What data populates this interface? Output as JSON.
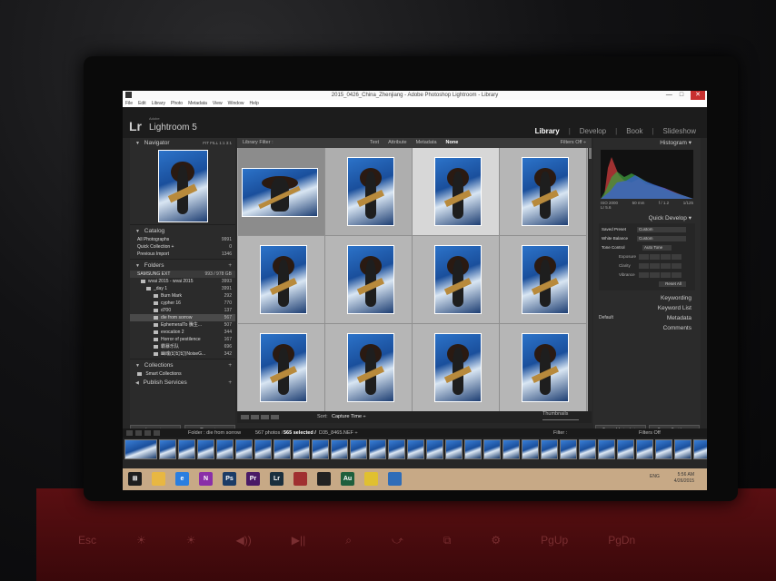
{
  "window": {
    "title": "2015_0426_China_Zhenjiang - Adobe Photoshop Lightroom - Library",
    "minimize": "—",
    "maximize": "□",
    "close": "✕"
  },
  "menu": [
    "File",
    "Edit",
    "Library",
    "Photo",
    "Metadata",
    "View",
    "Window",
    "Help"
  ],
  "identity": {
    "logo": "Lr",
    "brand": "Adobe",
    "product": "Lightroom 5"
  },
  "modules": {
    "items": [
      "Library",
      "Develop",
      "Book",
      "Slideshow"
    ],
    "active": "Library",
    "sep": "|"
  },
  "left": {
    "navigator": {
      "title": "Navigator",
      "zoom": "FIT FILL 1:1 3:1"
    },
    "catalog": {
      "title": "Catalog",
      "items": [
        {
          "label": "All Photographs",
          "count": "9991"
        },
        {
          "label": "Quick Collection +",
          "count": "0"
        },
        {
          "label": "Previous Import",
          "count": "1346"
        }
      ]
    },
    "folders": {
      "title": "Folders",
      "volume": {
        "label": "SAMSUNG EXT",
        "count": "993 / 978 GB"
      },
      "items": [
        {
          "label": "wvai 2015 - wvai 2015",
          "count": "3993"
        },
        {
          "label": "_day 1",
          "count": "3991"
        },
        {
          "label": "Burn Mark",
          "count": "292"
        },
        {
          "label": "cypher 16",
          "count": "770"
        },
        {
          "label": "d700",
          "count": "137"
        },
        {
          "label": "die from sorrow",
          "count": "567"
        },
        {
          "label": "EphemeralTo 騰生...",
          "count": "507"
        },
        {
          "label": "evocation 2",
          "count": "344"
        },
        {
          "label": "Horror of pestilence",
          "count": "167"
        },
        {
          "label": "霸暴乐队",
          "count": "696"
        },
        {
          "label": "幽魂(幻幻幻)NoiseG...",
          "count": "342"
        }
      ],
      "selected_index": 5
    },
    "collections": {
      "title": "Collections",
      "smart": "Smart Collections"
    },
    "publish": {
      "title": "Publish Services"
    },
    "import_label": "Import...",
    "export_label": "Export..."
  },
  "filter": {
    "label": "Library Filter :",
    "options": [
      "Text",
      "Attribute",
      "Metadata",
      "None"
    ],
    "active": "None",
    "filters_off": "Filters Off ÷"
  },
  "grid": {
    "cells": 12,
    "selected": [
      2,
      3,
      4,
      5,
      6,
      7,
      8,
      9,
      10,
      11
    ]
  },
  "toolbar": {
    "sort_label": "Sort:",
    "sort_value": "Capture Time ÷",
    "thumbnails": "Thumbnails"
  },
  "right": {
    "histogram": {
      "title": "Histogram",
      "iso": "ISO 2000",
      "focal": "50 mm",
      "aperture": "f / 1.2",
      "shutter": "1/125",
      "preview": "Lr 5.6"
    },
    "quick_develop": {
      "title": "Quick Develop",
      "saved_preset": {
        "label": "Saved Preset",
        "value": "Custom"
      },
      "white_balance": {
        "label": "White Balance",
        "value": "Custom"
      },
      "tone_control": {
        "label": "Tone Control",
        "value": "Auto Tone"
      },
      "rows": [
        "Exposure",
        "Clarity",
        "Vibrance"
      ],
      "reset": "Reset All"
    },
    "keywording": "Keywording",
    "keyword_list": "Keyword List",
    "metadata": "Metadata",
    "metadata_preset": "Default",
    "comments": "Comments",
    "sync_metadata": "Sync Metadata",
    "sync_settings": "Sync Settings"
  },
  "filmstrip": {
    "source": "Folder : die from sorrow",
    "count": "567 photos /",
    "selected": "565 selected /",
    "filename": "D35_8465.NEF ÷",
    "filter_label": "Filter :",
    "filters_off": "Filters Off",
    "thumbs": 30
  },
  "taskbar": {
    "apps": [
      "start",
      "folder",
      "ie",
      "onenote",
      "photoshop",
      "premiere",
      "lightroom",
      "photos",
      "app-dark",
      "audition",
      "chrome",
      "pen"
    ],
    "tray": "ENG",
    "time": "5:56 AM",
    "date": "4/26/2015"
  },
  "keyboard_keys": [
    "Esc",
    "☀",
    "☀",
    "◀))",
    "▶||",
    "⌕",
    "⤻",
    "⧉",
    "⚙",
    "PgUp",
    "PgDn"
  ]
}
